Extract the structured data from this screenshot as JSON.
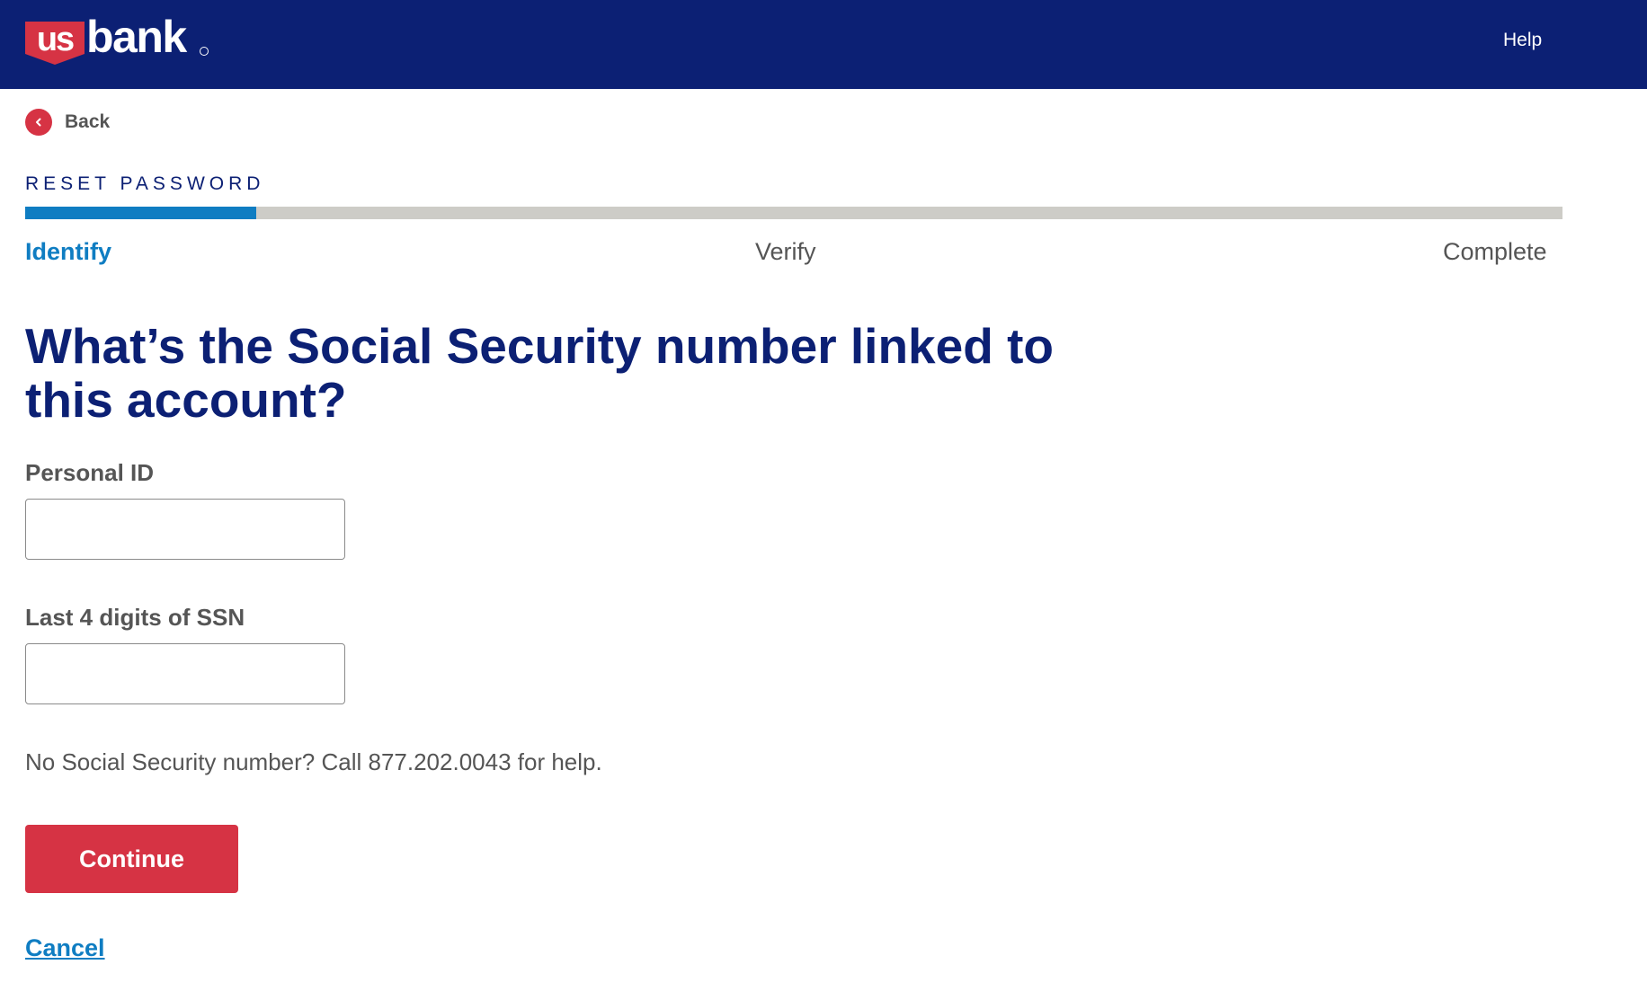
{
  "colors": {
    "header_bg": "#0c2074",
    "brand_red": "#d63344",
    "accent_blue": "#0f7dc2",
    "title_navy": "#0c2074",
    "text_gray": "#555555",
    "track_gray": "#cdccc7"
  },
  "header": {
    "logo": {
      "us": "us",
      "bank": "bank"
    },
    "help_label": "Help"
  },
  "back": {
    "icon": "chevron-left-icon",
    "label": "Back"
  },
  "flow": {
    "name": "RESET PASSWORD",
    "progress": 0.15,
    "steps": [
      {
        "label": "Identify",
        "active": true
      },
      {
        "label": "Verify",
        "active": false
      },
      {
        "label": "Complete",
        "active": false
      }
    ]
  },
  "page_title": "What’s the Social Security number linked to this account?",
  "form": {
    "personal_id": {
      "label": "Personal ID",
      "value": ""
    },
    "ssn_last4": {
      "label": "Last 4 digits of SSN",
      "value": ""
    },
    "helper_text": "No Social Security number? Call 877.202.0043 for help.",
    "continue_label": "Continue",
    "cancel_label": "Cancel"
  }
}
